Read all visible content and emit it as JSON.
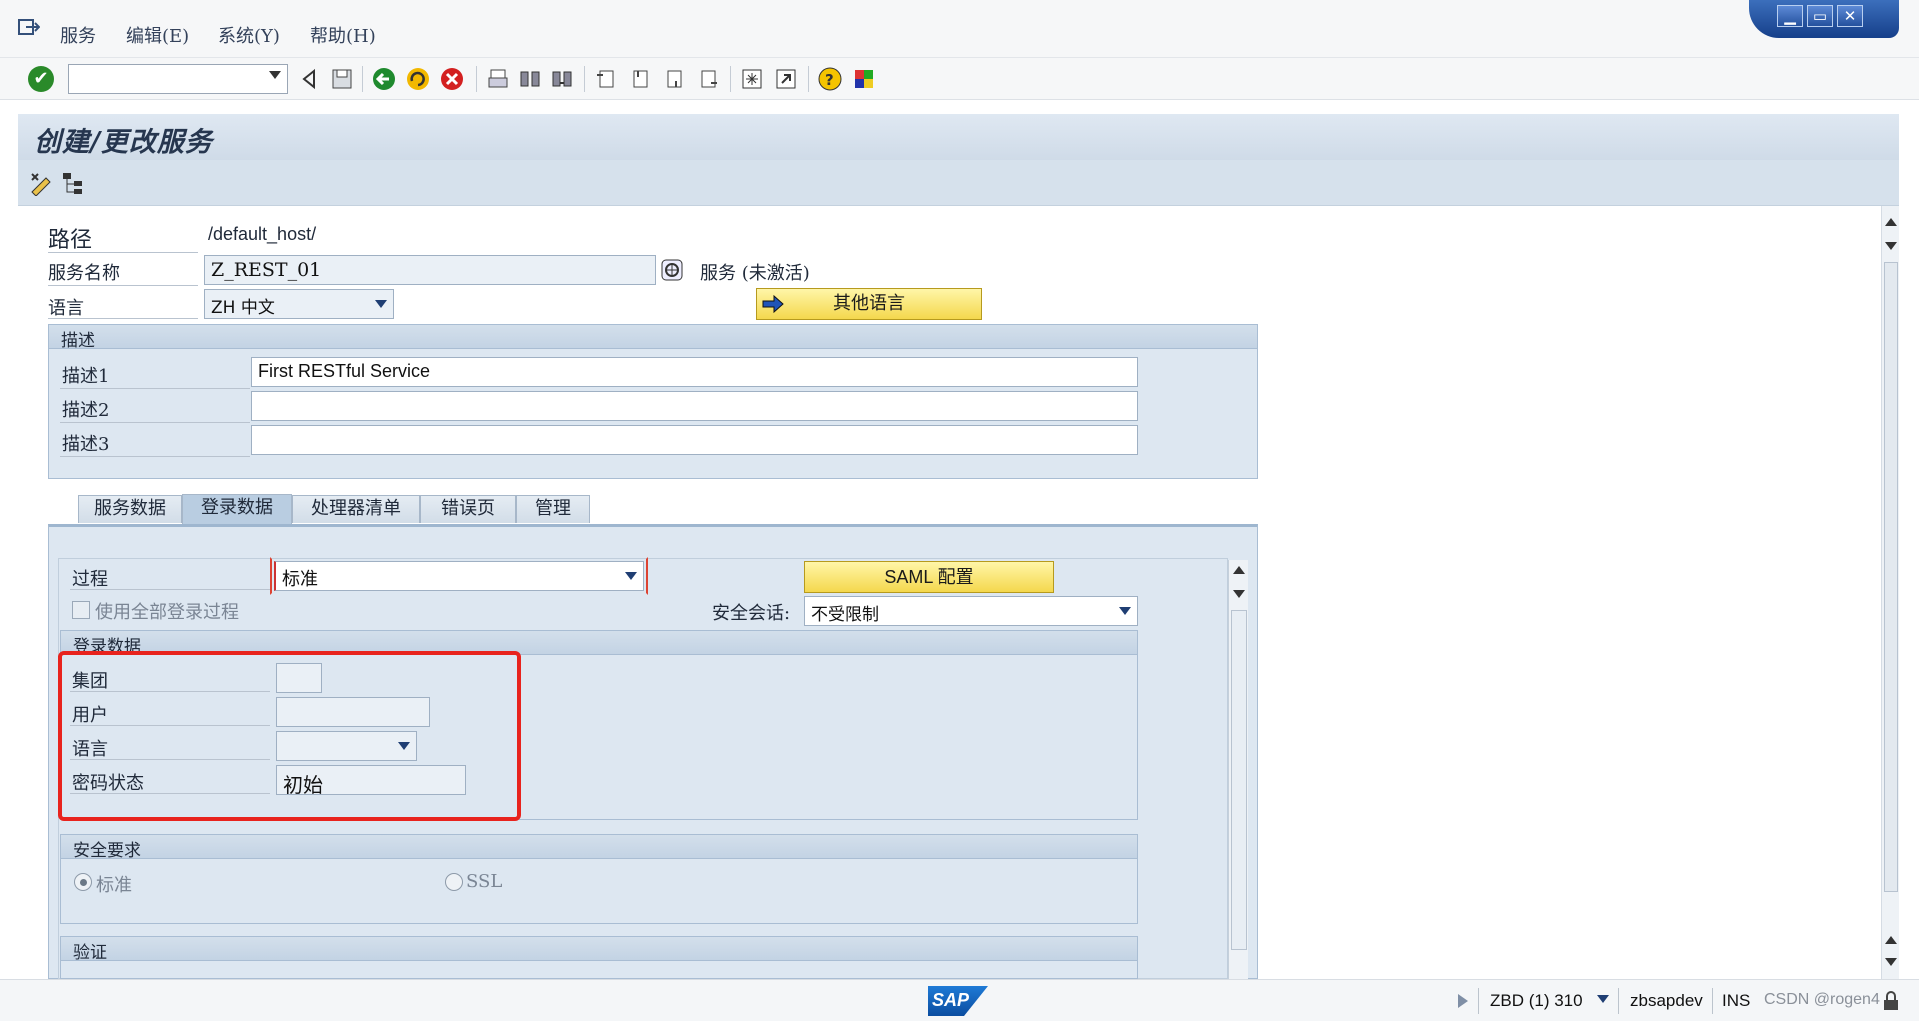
{
  "menu": {
    "items": [
      "服务",
      "编辑(E)",
      "系统(Y)",
      "帮助(H)"
    ]
  },
  "window_controls": {
    "minimize": "▁",
    "restore": "▭",
    "close": "✕"
  },
  "toolbar": {
    "ok_symbol": "✔",
    "command_field_value": ""
  },
  "title": "创建/更改服务",
  "form": {
    "path_label": "路径",
    "path_value": "/default_host/",
    "service_name_label": "服务名称",
    "service_name_value": "Z_REST_01",
    "service_status": "服务 (未激活)",
    "language_label": "语言",
    "language_value": "ZH 中文",
    "other_languages_button": "其他语言"
  },
  "description_group": {
    "title": "描述",
    "rows": [
      {
        "label": "描述1",
        "value": "First RESTful Service"
      },
      {
        "label": "描述2",
        "value": ""
      },
      {
        "label": "描述3",
        "value": ""
      }
    ]
  },
  "tabs": [
    {
      "label": "服务数据",
      "active": false
    },
    {
      "label": "登录数据",
      "active": true
    },
    {
      "label": "处理器清单",
      "active": false
    },
    {
      "label": "错误页",
      "active": false
    },
    {
      "label": "管理",
      "active": false
    }
  ],
  "login_tab": {
    "procedure_label": "过程",
    "procedure_value": "标准",
    "saml_button": "SAML 配置",
    "use_all_checkbox_label": "使用全部登录过程",
    "use_all_checked": false,
    "secure_session_label": "安全会话:",
    "secure_session_value": "不受限制",
    "login_data_group": {
      "title": "登录数据",
      "client_label": "集团",
      "client_value": "",
      "user_label": "用户",
      "user_value": "",
      "language_label": "语言",
      "language_value": "",
      "password_status_label": "密码状态",
      "password_status_value": "初始"
    },
    "security_group": {
      "title": "安全要求",
      "option_standard": "标准",
      "option_ssl": "SSL",
      "selected": "标准"
    },
    "auth_group": {
      "title": "验证"
    }
  },
  "status_bar": {
    "system": "ZBD (1) 310",
    "server": "zbsapdev",
    "mode": "INS",
    "watermark": "CSDN @rogen4"
  },
  "colors": {
    "highlight_box": "#e8231d",
    "yellow_button": "#f4d84d",
    "panel_blue": "#dde7f1"
  }
}
